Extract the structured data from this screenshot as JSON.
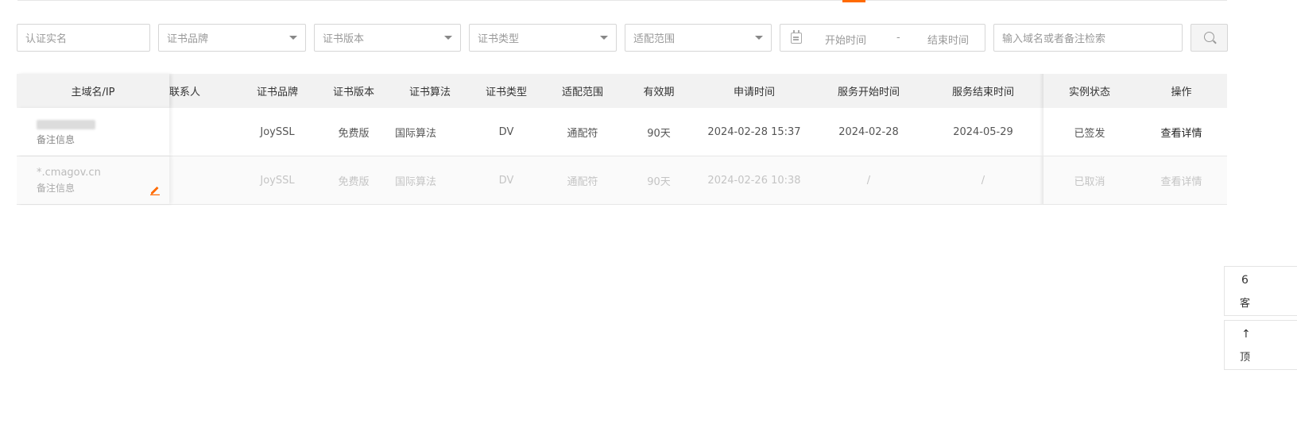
{
  "filters": {
    "cert_name_placeholder": "认证实名",
    "brand_placeholder": "证书品牌",
    "version_placeholder": "证书版本",
    "type_placeholder": "证书类型",
    "scope_placeholder": "适配范围",
    "date_start_placeholder": "开始时间",
    "date_separator": "-",
    "date_end_placeholder": "结束时间",
    "search_placeholder": "输入域名或者备注检索"
  },
  "table": {
    "headers": {
      "domain": "主域名/IP",
      "contact": "联系人",
      "brand": "证书品牌",
      "version": "证书版本",
      "algorithm": "证书算法",
      "type": "证书类型",
      "scope": "适配范围",
      "validity": "有效期",
      "apply_time": "申请时间",
      "service_start": "服务开始时间",
      "service_end": "服务结束时间",
      "status": "实例状态",
      "action": "操作"
    },
    "rows": [
      {
        "domain": "",
        "note": "备注信息",
        "contact": "",
        "brand": "JoySSL",
        "version": "免费版",
        "algorithm": "国际算法",
        "type": "DV",
        "scope": "通配符",
        "validity": "90天",
        "apply_time": "2024-02-28 15:37",
        "service_start": "2024-02-28",
        "service_end": "2024-05-29",
        "status": "已签发",
        "action": "查看详情"
      },
      {
        "domain": "*.cmagov.cn",
        "note": "备注信息",
        "contact": "",
        "brand": "JoySSL",
        "version": "免费版",
        "algorithm": "国际算法",
        "type": "DV",
        "scope": "通配符",
        "validity": "90天",
        "apply_time": "2024-02-26 10:38",
        "service_start": "/",
        "service_end": "/",
        "status": "已取消",
        "action": "查看详情"
      }
    ]
  },
  "float_widgets": [
    {
      "top": "6",
      "bottom": "客"
    },
    {
      "top": "↑",
      "bottom": "顶"
    }
  ],
  "colors": {
    "accent": "#ff6a00",
    "header_bg": "#f2f2f2",
    "border": "#d6d6d6"
  }
}
